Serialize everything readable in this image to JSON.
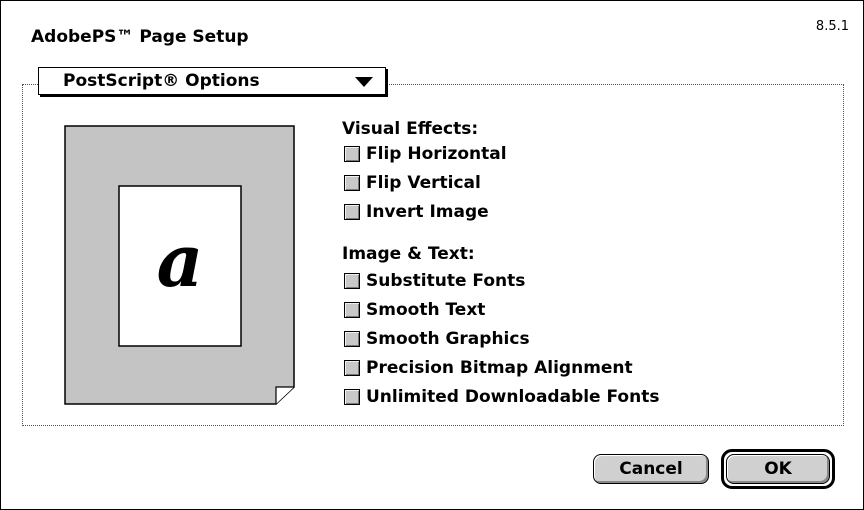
{
  "dialog": {
    "title": "AdobePS™ Page Setup",
    "version": "8.5.1"
  },
  "panel_popup": {
    "selected": "PostScript® Options"
  },
  "preview": {
    "glyph": "a"
  },
  "visual_effects": {
    "heading": "Visual Effects:",
    "options": [
      {
        "label": "Flip Horizontal",
        "checked": false
      },
      {
        "label": "Flip Vertical",
        "checked": false
      },
      {
        "label": "Invert Image",
        "checked": false
      }
    ]
  },
  "image_text": {
    "heading": "Image & Text:",
    "options": [
      {
        "label": "Substitute Fonts",
        "checked": false
      },
      {
        "label": "Smooth Text",
        "checked": false
      },
      {
        "label": "Smooth Graphics",
        "checked": false
      },
      {
        "label": "Precision Bitmap Alignment",
        "checked": false
      },
      {
        "label": "Unlimited Downloadable Fonts",
        "checked": false
      }
    ]
  },
  "buttons": {
    "cancel": "Cancel",
    "ok": "OK"
  }
}
